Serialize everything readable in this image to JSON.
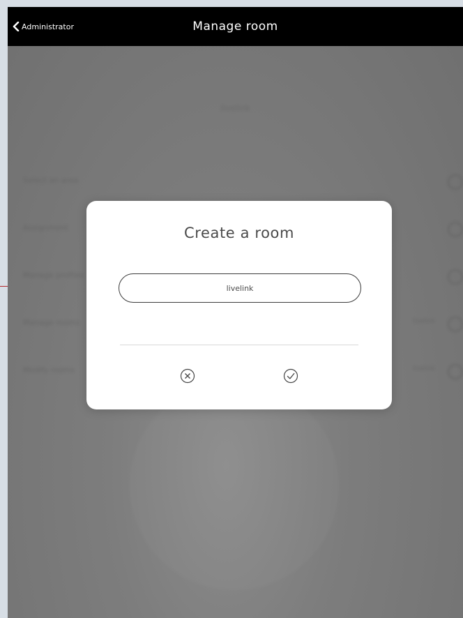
{
  "navbar": {
    "back_label": "Administrator",
    "title": "Manage room"
  },
  "background": {
    "heading": "livelink",
    "rows": [
      {
        "label": "Select an area",
        "value": ""
      },
      {
        "label": "Assignment",
        "value": ""
      },
      {
        "label": "Manage profiles",
        "value": ""
      },
      {
        "label": "Manage rooms",
        "value": "livelink"
      },
      {
        "label": "Modify rooms",
        "value": "livelink"
      }
    ]
  },
  "dialog": {
    "title": "Create a room",
    "input_value": "livelink",
    "input_placeholder": "",
    "cancel_icon": "cancel-circle-icon",
    "confirm_icon": "check-circle-icon"
  },
  "colors": {
    "navbar_bg": "#000000",
    "overlay": "#7a7a7a",
    "dialog_bg": "#ffffff",
    "callout": "#b3262a",
    "page_bg": "#d7dee5"
  }
}
